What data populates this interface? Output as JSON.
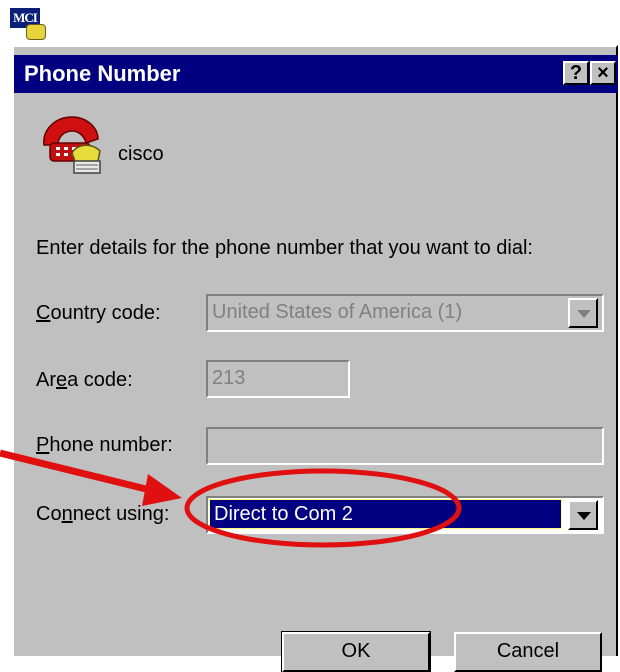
{
  "taskbar_icon": {
    "text": "MCI"
  },
  "dialog": {
    "title": "Phone Number",
    "help_button": "?",
    "close_button": "×",
    "entry_name": "cisco",
    "instructions": "Enter details for the phone number that you want to dial:",
    "country_code": {
      "label": "Country code:",
      "value": "United States of America (1)",
      "enabled": false
    },
    "area_code": {
      "label": "Area code:",
      "value": "213",
      "enabled": false
    },
    "phone_number": {
      "label": "Phone number:",
      "value": "",
      "enabled": false
    },
    "connect_using": {
      "label": "Connect using:",
      "value": "Direct to Com 2",
      "enabled": true
    },
    "ok_label": "OK",
    "cancel_label": "Cancel"
  },
  "annotation": {
    "color": "#e01010"
  },
  "icons": [
    "mci-app-icon",
    "phone-icon",
    "help-icon",
    "close-icon",
    "chevron-down-icon"
  ]
}
